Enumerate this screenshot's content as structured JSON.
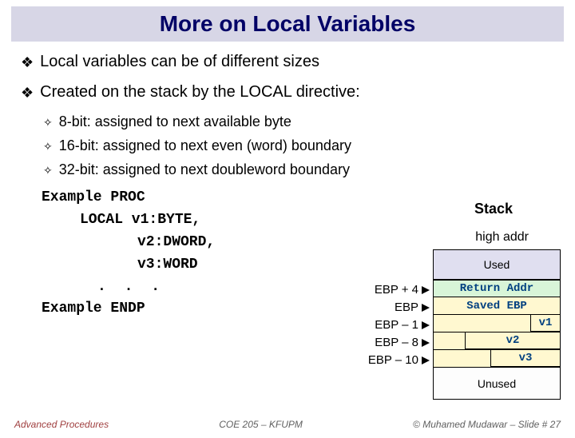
{
  "title": "More on Local Variables",
  "bullets": {
    "b1": "Local variables can be of different sizes",
    "b2": "Created on the stack by the LOCAL directive:",
    "s1": "8-bit: assigned to next available byte",
    "s2": "16-bit: assigned to next even (word) boundary",
    "s3": "32-bit: assigned to next doubleword boundary"
  },
  "labels": {
    "stack": "Stack",
    "high_addr": "high addr",
    "used": "Used",
    "return_addr": "Return Addr",
    "saved_ebp": "Saved EBP",
    "unused": "Unused"
  },
  "code": {
    "l1": "Example PROC",
    "l2": "LOCAL v1:BYTE,",
    "l3": "v2:DWORD,",
    "l4": "v3:WORD",
    "dots": ". . .",
    "l5": "Example ENDP"
  },
  "offsets": {
    "o1": "EBP + 4",
    "o2": "EBP",
    "o3": "EBP – 1",
    "o4": "EBP – 8",
    "o5": "EBP – 10"
  },
  "vars": {
    "v1": "v1",
    "v2": "v2",
    "v3": "v3"
  },
  "footer": {
    "left": "Advanced Procedures",
    "center": "COE 205 – KFUPM",
    "right": "© Muhamed Mudawar – Slide # 27"
  }
}
